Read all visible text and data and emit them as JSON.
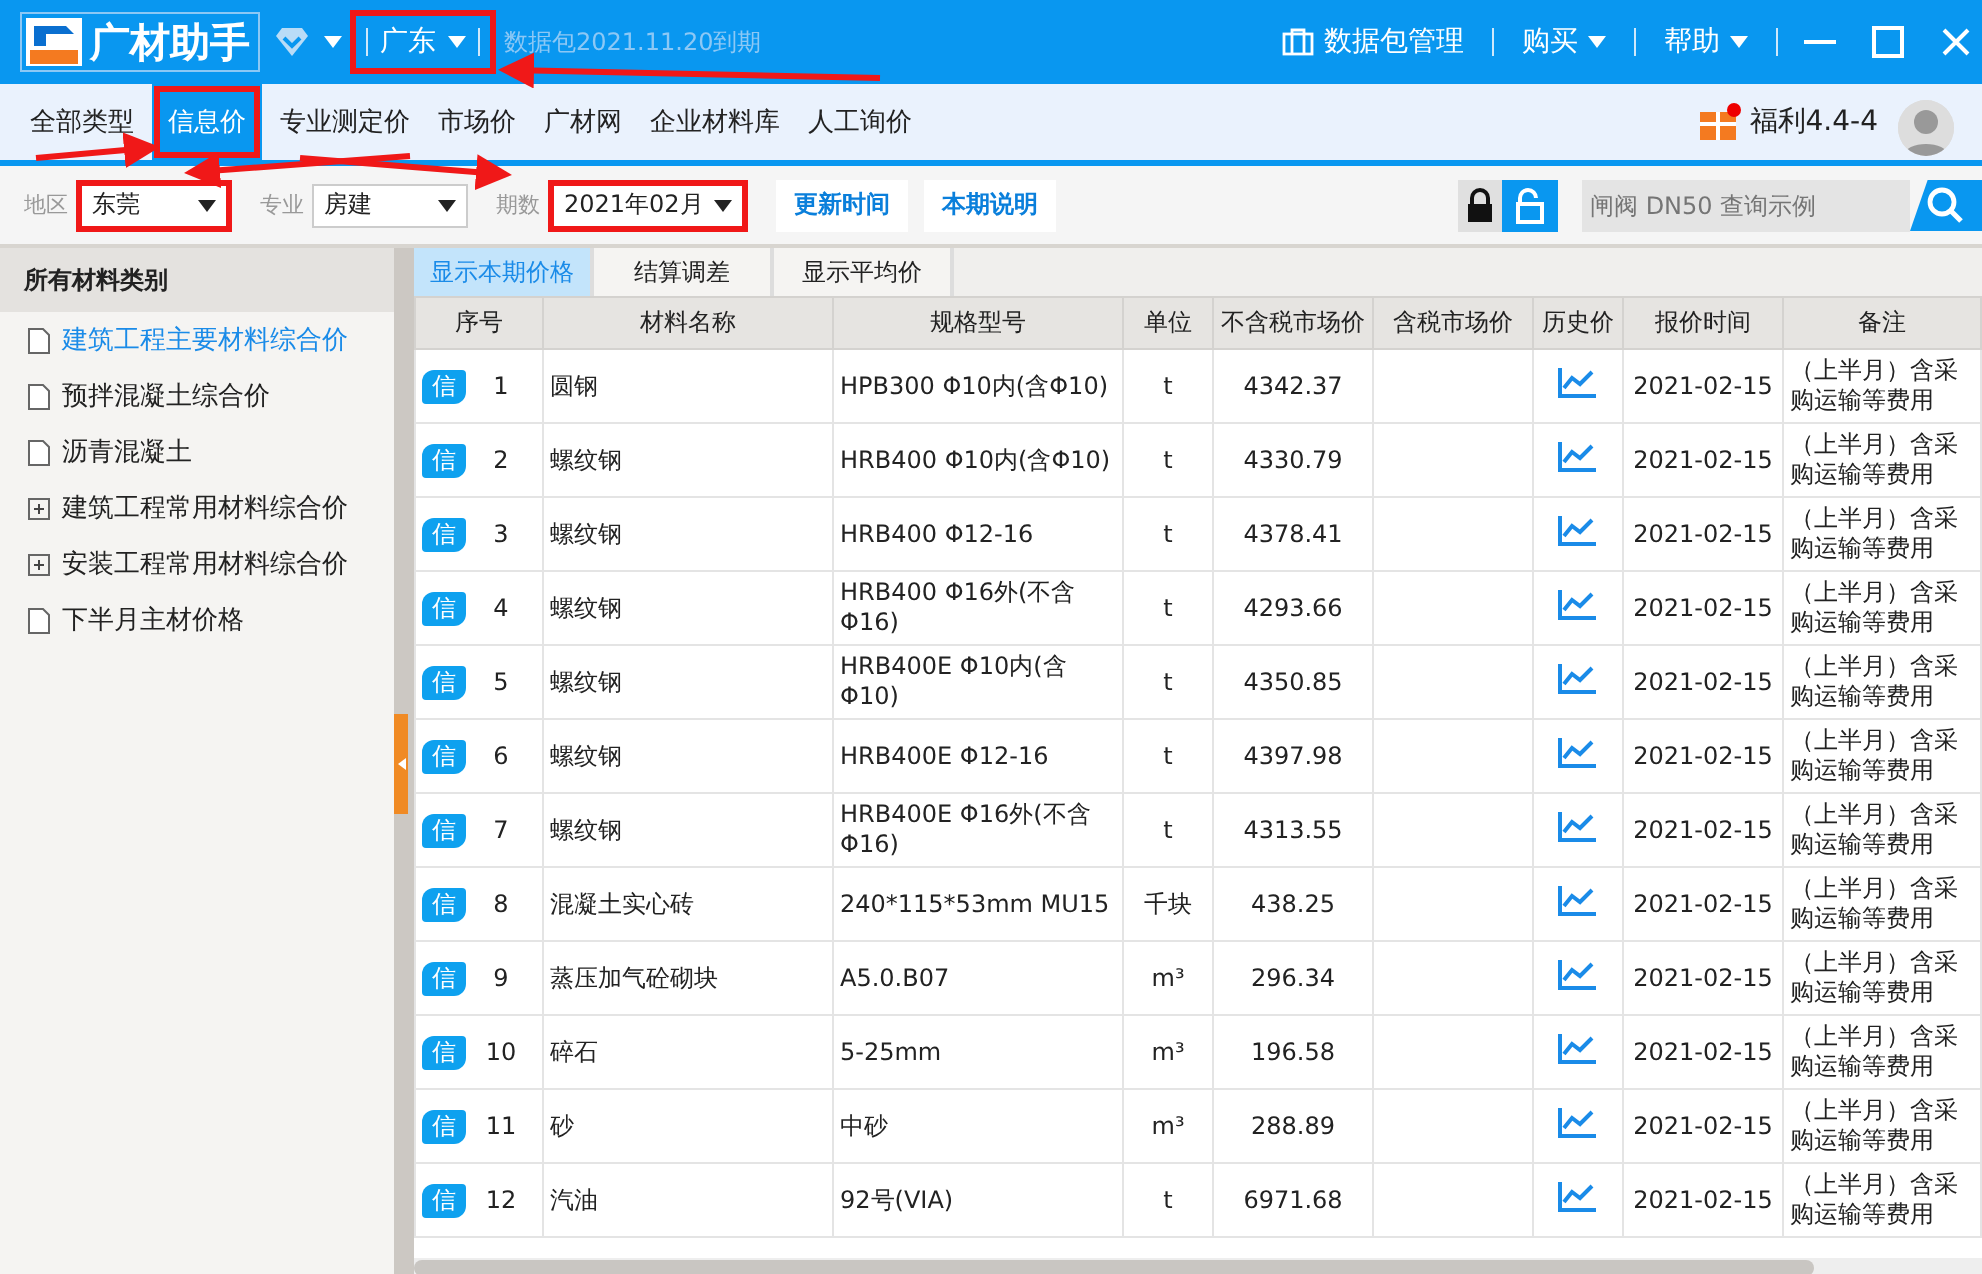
{
  "title_bar": {
    "logo_text": "广材助手",
    "region": "广东",
    "region_highlighted": true,
    "expiry": "数据包2021.11.20到期",
    "package_button": "数据包管理",
    "menus": [
      "购买",
      "帮助"
    ]
  },
  "nav_tabs": [
    {
      "label": "全部类型",
      "selected": false,
      "highlighted": false
    },
    {
      "label": "信息价",
      "selected": true,
      "highlighted": true
    },
    {
      "label": "专业测定价",
      "selected": false,
      "highlighted": false
    },
    {
      "label": "市场价",
      "selected": false,
      "highlighted": false
    },
    {
      "label": "广材网",
      "selected": false,
      "highlighted": false
    },
    {
      "label": "企业材料库",
      "selected": false,
      "highlighted": false
    },
    {
      "label": "人工询价",
      "selected": false,
      "highlighted": false
    }
  ],
  "welfare": "福利4.4-4",
  "filters": [
    {
      "label": "地区",
      "value": "东莞",
      "highlighted": true
    },
    {
      "label": "专业",
      "value": "房建",
      "highlighted": false
    },
    {
      "label": "期数",
      "value": "2021年02月",
      "highlighted": true
    }
  ],
  "filter_buttons": [
    "更新时间",
    "本期说明"
  ],
  "search": {
    "placeholder": "闸阀 DN50 查询示例"
  },
  "sidebar": {
    "title": "所有材料类别",
    "items": [
      {
        "label": "建筑工程主要材料综合价",
        "kind": "leaf",
        "selected": true
      },
      {
        "label": "预拌混凝土综合价",
        "kind": "leaf",
        "selected": false
      },
      {
        "label": "沥青混凝土",
        "kind": "leaf",
        "selected": false
      },
      {
        "label": "建筑工程常用材料综合价",
        "kind": "group",
        "selected": false
      },
      {
        "label": "安装工程常用材料综合价",
        "kind": "group",
        "selected": false
      },
      {
        "label": "下半月主材价格",
        "kind": "leaf",
        "selected": false
      }
    ]
  },
  "view_tabs": [
    {
      "label": "显示本期价格",
      "selected": true
    },
    {
      "label": "结算调差",
      "selected": false
    },
    {
      "label": "显示平均价",
      "selected": false
    }
  ],
  "table": {
    "columns": [
      "序号",
      "材料名称",
      "规格型号",
      "单位",
      "不含税市场价",
      "含税市场价",
      "历史价",
      "报价时间",
      "备注"
    ],
    "rows": [
      {
        "badge": "信",
        "no": "1",
        "name": "圆钢",
        "spec": "HPB300 Φ10内(含Φ10)",
        "unit": "t",
        "price": "4342.37",
        "date": "2021-02-15",
        "note": "（上半月）含采购运输等费用"
      },
      {
        "badge": "信",
        "no": "2",
        "name": "螺纹钢",
        "spec": "HRB400 Φ10内(含Φ10)",
        "unit": "t",
        "price": "4330.79",
        "date": "2021-02-15",
        "note": "（上半月）含采购运输等费用"
      },
      {
        "badge": "信",
        "no": "3",
        "name": "螺纹钢",
        "spec": "HRB400 Φ12-16",
        "unit": "t",
        "price": "4378.41",
        "date": "2021-02-15",
        "note": "（上半月）含采购运输等费用"
      },
      {
        "badge": "信",
        "no": "4",
        "name": "螺纹钢",
        "spec": "HRB400 Φ16外(不含Φ16)",
        "unit": "t",
        "price": "4293.66",
        "date": "2021-02-15",
        "note": "（上半月）含采购运输等费用"
      },
      {
        "badge": "信",
        "no": "5",
        "name": "螺纹钢",
        "spec": "HRB400E Φ10内(含Φ10)",
        "unit": "t",
        "price": "4350.85",
        "date": "2021-02-15",
        "note": "（上半月）含采购运输等费用"
      },
      {
        "badge": "信",
        "no": "6",
        "name": "螺纹钢",
        "spec": "HRB400E Φ12-16",
        "unit": "t",
        "price": "4397.98",
        "date": "2021-02-15",
        "note": "（上半月）含采购运输等费用"
      },
      {
        "badge": "信",
        "no": "7",
        "name": "螺纹钢",
        "spec": "HRB400E Φ16外(不含Φ16)",
        "unit": "t",
        "price": "4313.55",
        "date": "2021-02-15",
        "note": "（上半月）含采购运输等费用"
      },
      {
        "badge": "信",
        "no": "8",
        "name": "混凝土实心砖",
        "spec": "240*115*53mm MU15",
        "unit": "千块",
        "price": "438.25",
        "date": "2021-02-15",
        "note": "（上半月）含采购运输等费用"
      },
      {
        "badge": "信",
        "no": "9",
        "name": "蒸压加气砼砌块",
        "spec": "A5.0.B07",
        "unit": "m³",
        "price": "296.34",
        "date": "2021-02-15",
        "note": "（上半月）含采购运输等费用"
      },
      {
        "badge": "信",
        "no": "10",
        "name": "碎石",
        "spec": "5-25mm",
        "unit": "m³",
        "price": "196.58",
        "date": "2021-02-15",
        "note": "（上半月）含采购运输等费用"
      },
      {
        "badge": "信",
        "no": "11",
        "name": "砂",
        "spec": "中砂",
        "unit": "m³",
        "price": "288.89",
        "date": "2021-02-15",
        "note": "（上半月）含采购运输等费用"
      },
      {
        "badge": "信",
        "no": "12",
        "name": "汽油",
        "spec": "92号(VIA)",
        "unit": "t",
        "price": "6971.68",
        "date": "2021-02-15",
        "note": "（上半月）含采购运输等费用"
      }
    ]
  }
}
